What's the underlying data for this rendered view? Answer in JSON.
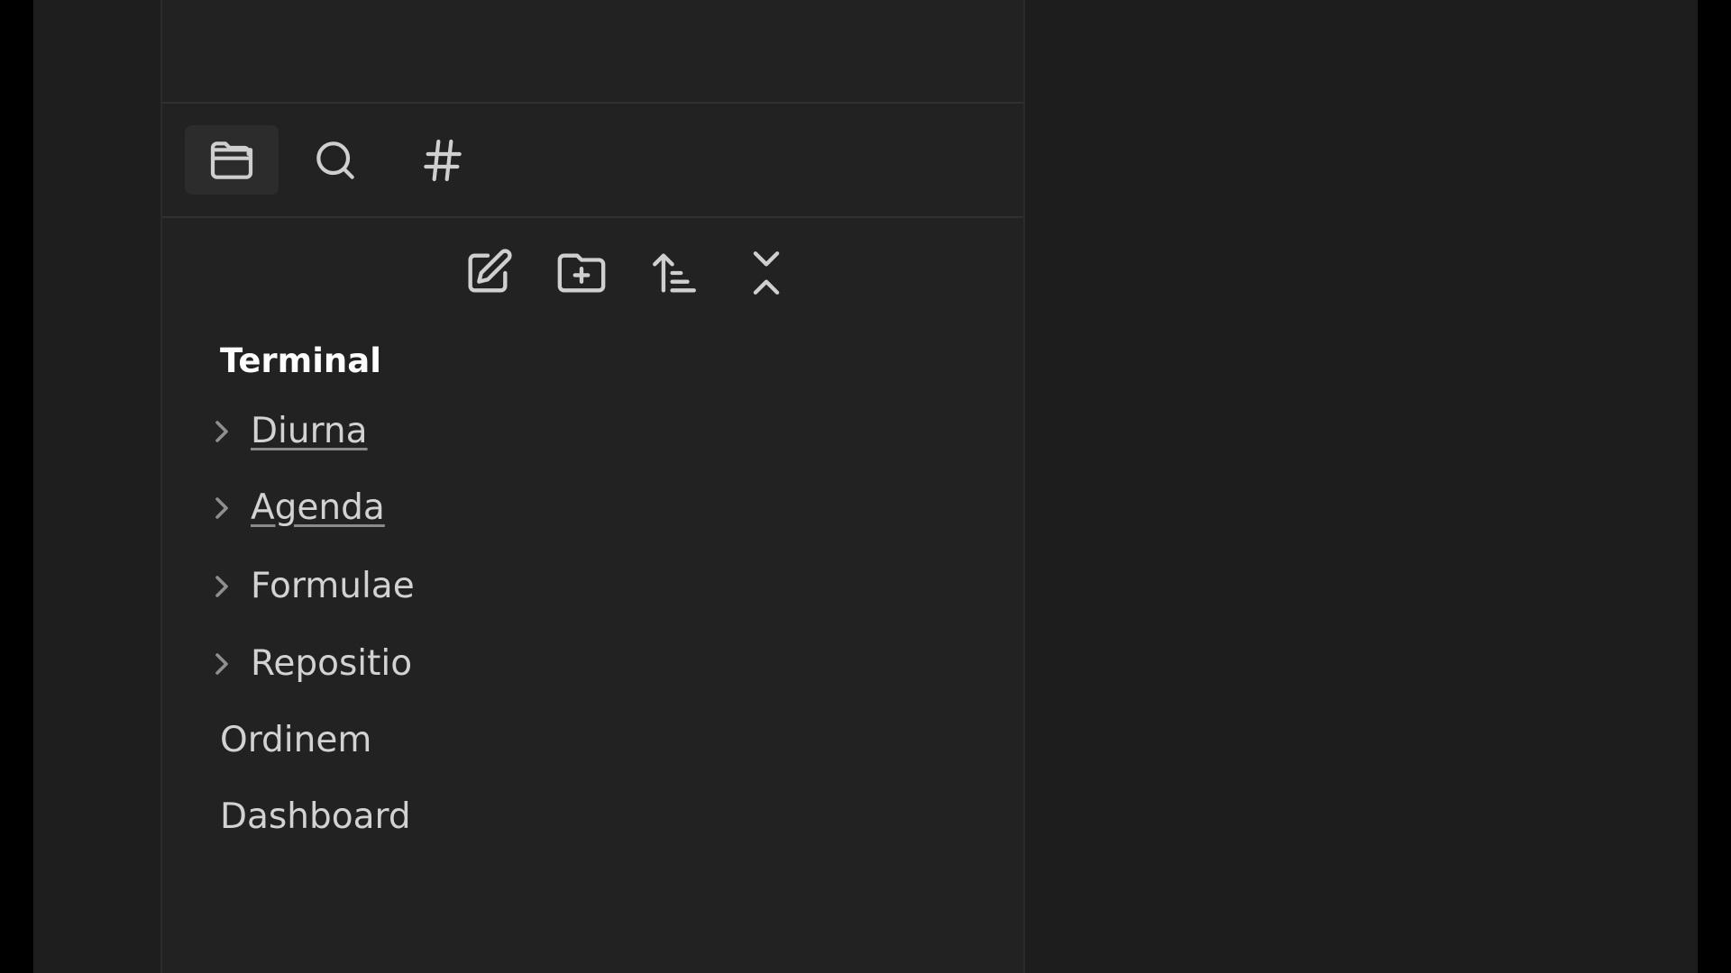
{
  "sidebar": {
    "tabs": [
      {
        "icon": "folder-icon",
        "active": true
      },
      {
        "icon": "search-icon",
        "active": false
      },
      {
        "icon": "hash-icon",
        "active": false
      }
    ],
    "toolbar": [
      {
        "icon": "new-note-icon"
      },
      {
        "icon": "new-folder-icon"
      },
      {
        "icon": "sort-icon"
      },
      {
        "icon": "collapse-all-icon"
      }
    ],
    "vault_name": "Terminal",
    "folders": [
      {
        "label": "Diurna",
        "linked": true
      },
      {
        "label": "Agenda",
        "linked": true
      },
      {
        "label": "Formulae",
        "linked": false
      },
      {
        "label": "Repositio",
        "linked": false
      }
    ],
    "files": [
      {
        "label": "Ordinem"
      },
      {
        "label": "Dashboard"
      }
    ]
  },
  "colors": {
    "background": "#1e1e1e",
    "sidebar": "#222222",
    "active_tab": "#2c2c2c",
    "text": "#d2d2d2",
    "heading": "#ffffff",
    "icon": "#cfcfcf"
  }
}
